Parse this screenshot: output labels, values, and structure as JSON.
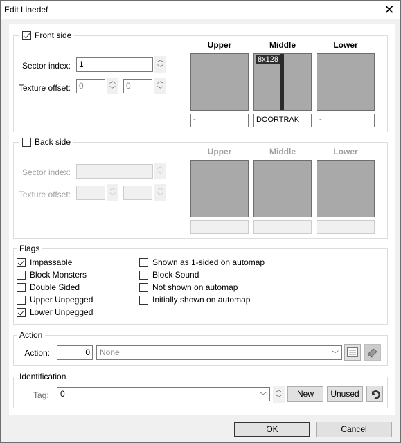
{
  "window": {
    "title": "Edit Linedef",
    "close_icon": "close-icon"
  },
  "front_side": {
    "legend": "Front side",
    "checked": true,
    "sector_index_label": "Sector index:",
    "sector_index_value": "1",
    "texture_offset_label": "Texture offset:",
    "offset_x": "0",
    "offset_y": "0",
    "columns": [
      {
        "header": "Upper",
        "texture": "-",
        "size": ""
      },
      {
        "header": "Middle",
        "texture": "DOORTRAK",
        "size": "8x128"
      },
      {
        "header": "Lower",
        "texture": "-",
        "size": ""
      }
    ]
  },
  "back_side": {
    "legend": "Back side",
    "checked": false,
    "sector_index_label": "Sector index:",
    "sector_index_value": "",
    "texture_offset_label": "Texture offset:",
    "offset_x": "",
    "offset_y": "",
    "columns": [
      {
        "header": "Upper",
        "texture": ""
      },
      {
        "header": "Middle",
        "texture": ""
      },
      {
        "header": "Lower",
        "texture": ""
      }
    ]
  },
  "flags": {
    "legend": "Flags",
    "left": [
      {
        "label": "Impassable",
        "checked": true
      },
      {
        "label": "Block Monsters",
        "checked": false
      },
      {
        "label": "Double Sided",
        "checked": false
      },
      {
        "label": "Upper Unpegged",
        "checked": false
      },
      {
        "label": "Lower Unpegged",
        "checked": true
      }
    ],
    "right": [
      {
        "label": "Shown as 1-sided on automap",
        "checked": false
      },
      {
        "label": "Block Sound",
        "checked": false
      },
      {
        "label": "Not shown on automap",
        "checked": false
      },
      {
        "label": "Initially shown on automap",
        "checked": false
      }
    ]
  },
  "action": {
    "legend": "Action",
    "label": "Action:",
    "number": "0",
    "selected": "None",
    "browse_icon": "list-icon",
    "help_icon": "book-icon"
  },
  "identification": {
    "legend": "Identification",
    "tag_label": "Tag:",
    "tag_value": "0",
    "new_label": "New",
    "unused_label": "Unused",
    "reset_icon": "undo-icon"
  },
  "footer": {
    "ok_label": "OK",
    "cancel_label": "Cancel"
  }
}
